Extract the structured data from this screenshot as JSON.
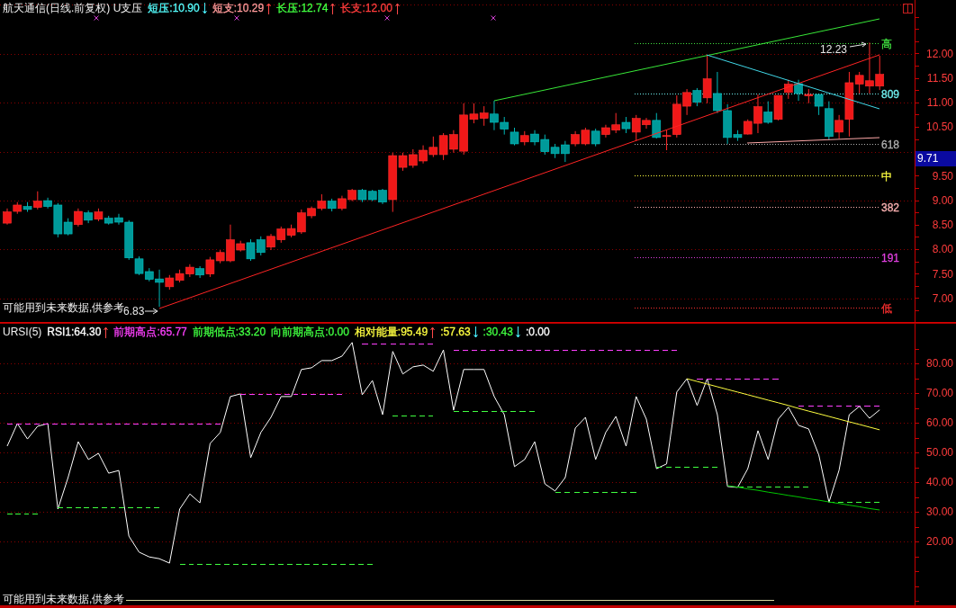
{
  "price_panel": {
    "title": "航天通信(日线.前复权) U支压",
    "readings": [
      {
        "label": "短压:10.90",
        "color": "#54fcfc",
        "rising": false
      },
      {
        "label": "短支:10.29",
        "color": "#ff9a9a",
        "rising": true
      },
      {
        "label": "长压:12.74",
        "color": "#40ff40",
        "rising": true
      },
      {
        "label": "长支:12.00",
        "color": "#ff3c3c",
        "rising": true
      }
    ],
    "levels": [
      {
        "label": "高",
        "color": "#40e040"
      },
      {
        "label": "809",
        "color": "#70f0f0"
      },
      {
        "label": "618",
        "color": "#b0b0b0"
      },
      {
        "label": "中",
        "color": "#ffff40"
      },
      {
        "label": "382",
        "color": "#ffb4b4"
      },
      {
        "label": "191",
        "color": "#e040e0"
      },
      {
        "label": "低",
        "color": "#ff3030"
      }
    ],
    "high_marker": "12.23",
    "low_marker": "6.83",
    "note": "可能用到未来数据,供参考",
    "current_price": "9.71",
    "chart_data": {
      "type": "candlestick",
      "grid": true,
      "ylim": [
        6.52,
        13.1
      ],
      "yticks": [
        {
          "value": 12,
          "label": "12.00"
        },
        {
          "value": 11.5,
          "label": "11.50"
        },
        {
          "value": 11,
          "label": "11.00"
        },
        {
          "value": 10.5,
          "label": "10.50"
        },
        {
          "value": 9.5,
          "label": "9.50"
        },
        {
          "value": 9,
          "label": "9.00"
        },
        {
          "value": 8.5,
          "label": "8.50"
        },
        {
          "value": 8,
          "label": "8.00"
        },
        {
          "value": 7.5,
          "label": "7.50"
        },
        {
          "value": 7,
          "label": "7.00"
        }
      ],
      "ohlc": [
        [
          8.54,
          8.84,
          8.51,
          8.77
        ],
        [
          8.78,
          8.97,
          8.73,
          8.91
        ],
        [
          8.88,
          8.97,
          8.77,
          8.82
        ],
        [
          8.86,
          9.19,
          8.82,
          8.99
        ],
        [
          9.0,
          9.06,
          8.84,
          8.88
        ],
        [
          8.91,
          8.95,
          8.25,
          8.32
        ],
        [
          8.56,
          8.64,
          8.29,
          8.32
        ],
        [
          8.51,
          8.84,
          8.47,
          8.78
        ],
        [
          8.75,
          8.8,
          8.54,
          8.6
        ],
        [
          8.62,
          8.84,
          8.58,
          8.77
        ],
        [
          8.64,
          8.69,
          8.51,
          8.54
        ],
        [
          8.65,
          8.73,
          8.51,
          8.56
        ],
        [
          8.56,
          8.6,
          7.79,
          7.83
        ],
        [
          7.81,
          7.86,
          7.48,
          7.51
        ],
        [
          7.55,
          7.62,
          7.35,
          7.39
        ],
        [
          7.4,
          7.59,
          6.83,
          7.33
        ],
        [
          7.24,
          7.48,
          7.18,
          7.42
        ],
        [
          7.37,
          7.59,
          7.33,
          7.51
        ],
        [
          7.5,
          7.7,
          7.44,
          7.64
        ],
        [
          7.61,
          7.66,
          7.42,
          7.48
        ],
        [
          7.5,
          7.85,
          7.44,
          7.79
        ],
        [
          7.77,
          7.99,
          7.72,
          7.94
        ],
        [
          7.77,
          8.51,
          7.74,
          8.2
        ],
        [
          7.99,
          8.18,
          7.96,
          8.12
        ],
        [
          8.14,
          8.21,
          7.77,
          7.81
        ],
        [
          8.2,
          8.27,
          7.88,
          7.94
        ],
        [
          8.05,
          8.32,
          7.99,
          8.27
        ],
        [
          8.2,
          8.47,
          8.14,
          8.42
        ],
        [
          8.29,
          8.51,
          8.25,
          8.43
        ],
        [
          8.36,
          8.82,
          8.32,
          8.75
        ],
        [
          8.69,
          8.88,
          8.64,
          8.84
        ],
        [
          8.84,
          9.13,
          8.8,
          8.99
        ],
        [
          8.99,
          9.04,
          8.78,
          8.84
        ],
        [
          8.84,
          9.1,
          8.8,
          9.04
        ],
        [
          9.02,
          9.24,
          8.99,
          9.21
        ],
        [
          9.21,
          9.24,
          8.97,
          9.02
        ],
        [
          9.19,
          9.22,
          8.99,
          9.02
        ],
        [
          9.21,
          9.24,
          8.93,
          8.97
        ],
        [
          9.02,
          9.98,
          8.77,
          9.92
        ],
        [
          9.68,
          9.98,
          9.61,
          9.92
        ],
        [
          9.72,
          10.05,
          9.67,
          9.94
        ],
        [
          9.81,
          10.13,
          9.76,
          10.03
        ],
        [
          9.94,
          10.31,
          9.89,
          10.09
        ],
        [
          9.94,
          10.38,
          9.83,
          10.33
        ],
        [
          10.05,
          10.44,
          9.98,
          10.35
        ],
        [
          10.01,
          10.99,
          9.94,
          10.75
        ],
        [
          10.66,
          10.99,
          10.58,
          10.77
        ],
        [
          10.68,
          10.93,
          10.53,
          10.79
        ],
        [
          10.77,
          11.04,
          10.44,
          10.6
        ],
        [
          10.6,
          10.71,
          10.35,
          10.46
        ],
        [
          10.4,
          10.49,
          10.13,
          10.16
        ],
        [
          10.2,
          10.42,
          10.13,
          10.33
        ],
        [
          10.36,
          10.44,
          10.13,
          10.2
        ],
        [
          10.25,
          10.35,
          9.94,
          10.0
        ],
        [
          10.09,
          10.16,
          9.87,
          9.96
        ],
        [
          10.14,
          10.22,
          9.79,
          9.96
        ],
        [
          10.16,
          10.42,
          10.11,
          10.35
        ],
        [
          10.16,
          10.49,
          10.13,
          10.44
        ],
        [
          10.42,
          10.47,
          10.11,
          10.16
        ],
        [
          10.35,
          10.55,
          10.29,
          10.49
        ],
        [
          10.44,
          10.79,
          10.38,
          10.55
        ],
        [
          10.6,
          10.71,
          10.38,
          10.47
        ],
        [
          10.4,
          10.75,
          10.22,
          10.68
        ],
        [
          10.55,
          10.69,
          10.47,
          10.64
        ],
        [
          10.64,
          10.79,
          10.27,
          10.29
        ],
        [
          10.31,
          10.44,
          10.03,
          10.33
        ],
        [
          10.35,
          11.15,
          10.29,
          10.97
        ],
        [
          10.93,
          11.28,
          10.75,
          11.21
        ],
        [
          11.25,
          11.3,
          10.93,
          11.01
        ],
        [
          11.1,
          11.98,
          10.99,
          11.49
        ],
        [
          11.19,
          11.63,
          10.79,
          10.84
        ],
        [
          10.84,
          10.97,
          10.16,
          10.29
        ],
        [
          10.35,
          10.44,
          10.22,
          10.29
        ],
        [
          10.36,
          10.66,
          10.35,
          10.62
        ],
        [
          10.58,
          11.17,
          10.38,
          10.92
        ],
        [
          10.81,
          11.03,
          10.57,
          10.6
        ],
        [
          10.66,
          11.15,
          10.64,
          11.15
        ],
        [
          11.21,
          11.47,
          11.08,
          11.38
        ],
        [
          11.39,
          11.47,
          11.04,
          11.19
        ],
        [
          11.14,
          11.28,
          10.99,
          11.17
        ],
        [
          11.17,
          11.17,
          10.75,
          10.93
        ],
        [
          10.88,
          11.03,
          10.24,
          10.31
        ],
        [
          10.4,
          10.75,
          10.27,
          10.64
        ],
        [
          10.66,
          11.63,
          10.31,
          11.41
        ],
        [
          11.38,
          11.63,
          11.19,
          11.56
        ],
        [
          11.34,
          12.23,
          11.19,
          11.45
        ],
        [
          11.34,
          11.96,
          11.26,
          11.58
        ]
      ]
    }
  },
  "rsi_panel": {
    "title": "URSI(5)",
    "readings": [
      {
        "label": "RSI1:64.30",
        "color": "#ffffff",
        "rising": true
      },
      {
        "label": "前期高点:65.77",
        "color": "#ff40ff"
      },
      {
        "label": "前期低点:33.20",
        "color": "#40ff40"
      },
      {
        "label": "向前期高点:0.00",
        "color": "#40ff40"
      },
      {
        "label": "相对能量:95.49",
        "color": "#ffff40",
        "rising": true
      },
      {
        "label": ":57.63",
        "color": "#ffff40",
        "rising": false
      },
      {
        "label": ":30.43",
        "color": "#40ff40",
        "rising": false
      },
      {
        "label": ":0.00",
        "color": "#ffffff"
      }
    ],
    "note": "可能用到未来数据,供参考",
    "chart_data": {
      "type": "line",
      "grid": true,
      "ylim": [
        -1.5,
        93.3
      ],
      "yticks": [
        {
          "value": 80,
          "label": "80.00"
        },
        {
          "value": 70,
          "label": "70.00"
        },
        {
          "value": 60,
          "label": "60.00"
        },
        {
          "value": 50,
          "label": "50.00"
        },
        {
          "value": 40,
          "label": "40.00"
        },
        {
          "value": 30,
          "label": "30.00"
        },
        {
          "value": 20,
          "label": "20.00"
        }
      ],
      "series": [
        {
          "color": "#ffffff",
          "values": [
            52.1,
            59.7,
            54.5,
            58.8,
            59.7,
            30.9,
            41.5,
            53.6,
            47.6,
            49.7,
            43.0,
            43.9,
            21.8,
            16.4,
            14.8,
            14.2,
            12.7,
            30.9,
            36.0,
            33.0,
            53.0,
            56.7,
            68.8,
            69.7,
            48.2,
            56.7,
            61.8,
            68.8,
            68.8,
            77.9,
            78.5,
            80.9,
            80.9,
            82.4,
            87.0,
            69.4,
            74.2,
            62.7,
            84.0,
            76.4,
            78.8,
            79.4,
            77.3,
            84.5,
            64.2,
            77.9,
            77.9,
            77.9,
            68.8,
            62.7,
            45.2,
            47.6,
            53.6,
            39.4,
            37.0,
            41.5,
            58.2,
            61.8,
            47.6,
            56.7,
            62.1,
            52.1,
            68.8,
            61.2,
            44.5,
            46.1,
            70.3,
            74.8,
            65.8,
            74.8,
            62.7,
            38.5,
            38.2,
            44.5,
            57.3,
            47.6,
            61.2,
            65.2,
            59.1,
            57.9,
            49.1,
            33.2,
            44.0,
            62.7,
            65.5,
            61.5,
            64.3
          ]
        },
        {
          "color": "#ff40ff",
          "line_style": "dashed",
          "values": [
            59.7,
            59.7,
            59.7,
            59.7,
            59.7,
            59.7,
            59.7,
            59.7,
            59.7,
            59.7,
            59.7,
            59.7,
            59.7,
            59.7,
            59.7,
            59.7,
            59.7,
            59.7,
            59.7,
            59.7,
            59.7,
            59.7,
            null,
            69.7,
            69.7,
            69.7,
            69.7,
            69.7,
            69.7,
            69.7,
            69.7,
            69.7,
            69.7,
            69.7,
            null,
            86.7,
            86.7,
            86.7,
            86.7,
            86.7,
            86.7,
            86.7,
            86.7,
            null,
            84.5,
            84.5,
            84.5,
            84.5,
            84.5,
            84.5,
            84.5,
            84.5,
            84.5,
            84.5,
            84.5,
            84.5,
            84.5,
            84.5,
            84.5,
            84.5,
            84.5,
            84.5,
            84.5,
            84.5,
            84.5,
            84.5,
            84.5,
            null,
            74.8,
            74.8,
            74.8,
            74.8,
            74.8,
            74.8,
            74.8,
            74.8,
            74.8,
            null,
            65.8,
            65.8,
            65.8,
            65.8,
            65.8,
            65.8,
            65.8,
            65.8,
            65.8
          ]
        },
        {
          "color": "#40ff40",
          "line_style": "dashed",
          "values": [
            29.4,
            29.4,
            29.4,
            29.4,
            null,
            31.5,
            31.5,
            31.5,
            31.5,
            31.5,
            31.5,
            31.5,
            31.5,
            31.5,
            31.5,
            31.5,
            null,
            12.4,
            12.4,
            12.4,
            12.4,
            12.4,
            12.4,
            12.4,
            12.4,
            12.4,
            12.4,
            12.4,
            12.4,
            12.4,
            12.4,
            12.4,
            12.4,
            12.4,
            12.4,
            12.4,
            12.4,
            null,
            62.4,
            62.4,
            62.4,
            62.4,
            62.4,
            null,
            63.9,
            63.9,
            63.9,
            63.9,
            63.9,
            63.9,
            63.9,
            63.9,
            63.9,
            null,
            36.7,
            36.7,
            36.7,
            36.7,
            36.7,
            36.7,
            36.7,
            36.7,
            36.7,
            null,
            45.2,
            45.2,
            45.2,
            45.2,
            45.2,
            45.2,
            45.2,
            null,
            38.5,
            38.5,
            38.5,
            38.5,
            38.5,
            38.5,
            38.5,
            38.5,
            null,
            33.2,
            33.2,
            33.2,
            33.2,
            33.2,
            33.2
          ]
        },
        {
          "color": "#ffff40",
          "values": [
            null,
            null,
            null,
            null,
            null,
            null,
            null,
            null,
            null,
            null,
            null,
            null,
            null,
            null,
            null,
            null,
            null,
            null,
            null,
            null,
            null,
            null,
            null,
            null,
            null,
            null,
            null,
            null,
            null,
            null,
            null,
            null,
            null,
            null,
            null,
            null,
            null,
            null,
            null,
            null,
            null,
            null,
            null,
            null,
            null,
            null,
            null,
            null,
            null,
            null,
            null,
            null,
            null,
            null,
            null,
            null,
            null,
            null,
            null,
            null,
            null,
            null,
            null,
            null,
            null,
            null,
            null,
            74.8,
            73.9,
            73.0,
            72.1,
            71.2,
            70.3,
            69.4,
            68.5,
            67.6,
            66.7,
            65.8,
            64.8,
            63.9,
            63.0,
            62.1,
            61.2,
            60.3,
            59.4,
            58.5,
            57.6
          ]
        },
        {
          "color": "#00c800",
          "values": [
            null,
            null,
            null,
            null,
            null,
            null,
            null,
            null,
            null,
            null,
            null,
            null,
            null,
            null,
            null,
            null,
            null,
            null,
            null,
            null,
            null,
            null,
            null,
            null,
            null,
            null,
            null,
            null,
            null,
            null,
            null,
            null,
            null,
            null,
            null,
            null,
            null,
            null,
            null,
            null,
            null,
            null,
            null,
            null,
            null,
            null,
            null,
            null,
            null,
            null,
            null,
            null,
            null,
            null,
            null,
            null,
            null,
            null,
            null,
            null,
            null,
            null,
            null,
            null,
            null,
            null,
            null,
            null,
            null,
            null,
            null,
            38.8,
            38.3,
            37.7,
            37.2,
            36.6,
            36.1,
            35.5,
            35.0,
            34.4,
            33.9,
            33.3,
            32.8,
            32.2,
            31.7,
            31.1,
            30.6
          ]
        }
      ]
    }
  }
}
